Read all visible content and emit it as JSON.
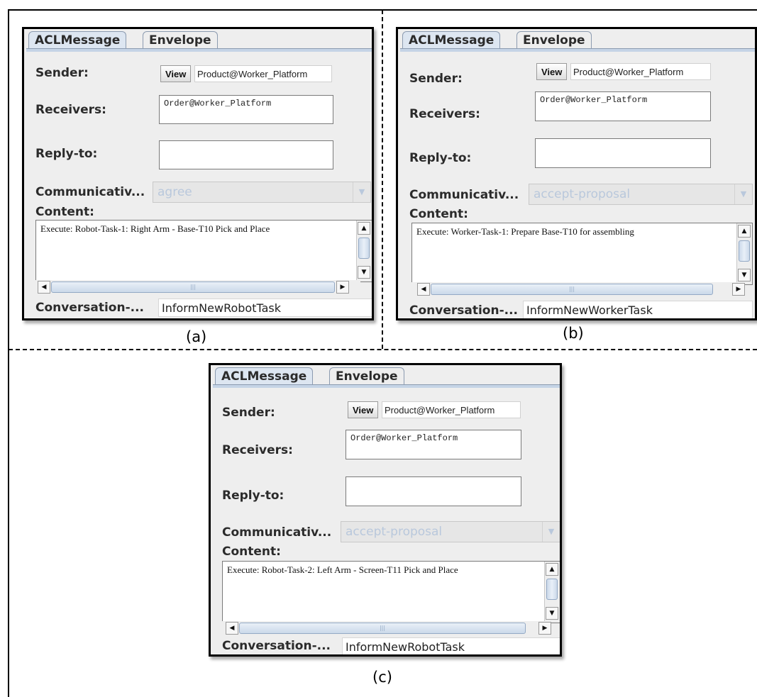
{
  "panels": [
    {
      "caption": "(a)",
      "tabs": [
        "ACLMessage",
        "Envelope"
      ],
      "sender_label": "Sender:",
      "view_button": "View",
      "sender_value": "Product@Worker_Platform",
      "receivers_label": "Receivers:",
      "receivers_value": "Order@Worker_Platform",
      "reply_to_label": "Reply-to:",
      "reply_to_value": "",
      "communicative_label": "Communicativ...",
      "communicative_value": "agree",
      "content_label": "Content:",
      "content_value": "Execute: Robot-Task-1: Right Arm - Base-T10 Pick and Place",
      "conversation_label": "Conversation-...",
      "conversation_value": "InformNewRobotTask"
    },
    {
      "caption": "(b)",
      "tabs": [
        "ACLMessage",
        "Envelope"
      ],
      "sender_label": "Sender:",
      "view_button": "View",
      "sender_value": "Product@Worker_Platform",
      "receivers_label": "Receivers:",
      "receivers_value": "Order@Worker_Platform",
      "reply_to_label": "Reply-to:",
      "reply_to_value": "",
      "communicative_label": "Communicativ...",
      "communicative_value": "accept-proposal",
      "content_label": "Content:",
      "content_value": "Execute: Worker-Task-1: Prepare Base-T10 for assembling",
      "conversation_label": "Conversation-...",
      "conversation_value": "InformNewWorkerTask"
    },
    {
      "caption": "(c)",
      "tabs": [
        "ACLMessage",
        "Envelope"
      ],
      "sender_label": "Sender:",
      "view_button": "View",
      "sender_value": "Product@Worker_Platform",
      "receivers_label": "Receivers:",
      "receivers_value": "Order@Worker_Platform",
      "reply_to_label": "Reply-to:",
      "reply_to_value": "",
      "communicative_label": "Communicativ...",
      "communicative_value": "accept-proposal",
      "content_label": "Content:",
      "content_value": "Execute: Robot-Task-2: Left Arm - Screen-T11 Pick and Place",
      "conversation_label": "Conversation-...",
      "conversation_value": "InformNewRobotTask"
    }
  ]
}
